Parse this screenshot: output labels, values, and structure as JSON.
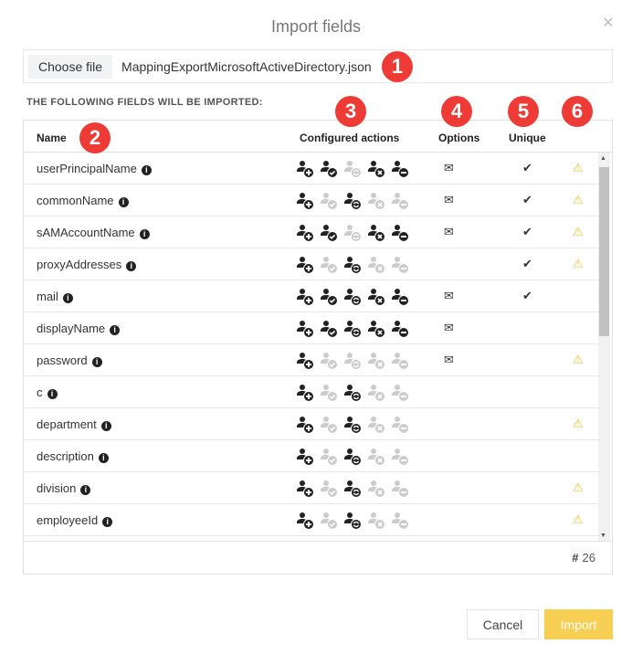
{
  "dialog": {
    "title": "Import fields",
    "close_icon": "close-icon"
  },
  "file": {
    "choose_label": "Choose file",
    "file_name": "MappingExportMicrosoftActiveDirectory.json"
  },
  "section_label": "THE FOLLOWING FIELDS WILL BE IMPORTED:",
  "table": {
    "headers": {
      "name": "Name",
      "actions": "Configured actions",
      "options": "Options",
      "unique": "Unique"
    },
    "action_types": [
      "add",
      "check",
      "sync",
      "delete",
      "remove"
    ],
    "colors": {
      "active": "#222222",
      "inactive": "#cccccc",
      "warning": "#f0c330"
    },
    "rows": [
      {
        "name": "userPrincipalName",
        "actions": [
          1,
          1,
          0,
          1,
          1
        ],
        "options": true,
        "unique": true,
        "warning": true
      },
      {
        "name": "commonName",
        "actions": [
          1,
          0,
          1,
          0,
          0
        ],
        "options": true,
        "unique": true,
        "warning": true
      },
      {
        "name": "sAMAccountName",
        "actions": [
          1,
          1,
          0,
          1,
          1
        ],
        "options": true,
        "unique": true,
        "warning": true
      },
      {
        "name": "proxyAddresses",
        "actions": [
          1,
          0,
          1,
          0,
          0
        ],
        "options": false,
        "unique": true,
        "warning": true
      },
      {
        "name": "mail",
        "actions": [
          1,
          1,
          1,
          1,
          1
        ],
        "options": true,
        "unique": true,
        "warning": false
      },
      {
        "name": "displayName",
        "actions": [
          1,
          1,
          1,
          1,
          1
        ],
        "options": true,
        "unique": false,
        "warning": false
      },
      {
        "name": "password",
        "actions": [
          1,
          0,
          0,
          0,
          0
        ],
        "options": true,
        "unique": false,
        "warning": true
      },
      {
        "name": "c",
        "actions": [
          1,
          0,
          1,
          0,
          0
        ],
        "options": false,
        "unique": false,
        "warning": false
      },
      {
        "name": "department",
        "actions": [
          1,
          0,
          1,
          0,
          0
        ],
        "options": false,
        "unique": false,
        "warning": true
      },
      {
        "name": "description",
        "actions": [
          1,
          0,
          1,
          0,
          0
        ],
        "options": false,
        "unique": false,
        "warning": false
      },
      {
        "name": "division",
        "actions": [
          1,
          0,
          1,
          0,
          0
        ],
        "options": false,
        "unique": false,
        "warning": true
      },
      {
        "name": "employeeId",
        "actions": [
          1,
          0,
          1,
          0,
          0
        ],
        "options": false,
        "unique": false,
        "warning": true
      }
    ],
    "count_label": "26"
  },
  "buttons": {
    "cancel": "Cancel",
    "import": "Import",
    "import_color": "#f7cf52"
  },
  "badges": [
    "1",
    "2",
    "3",
    "4",
    "5",
    "6"
  ]
}
